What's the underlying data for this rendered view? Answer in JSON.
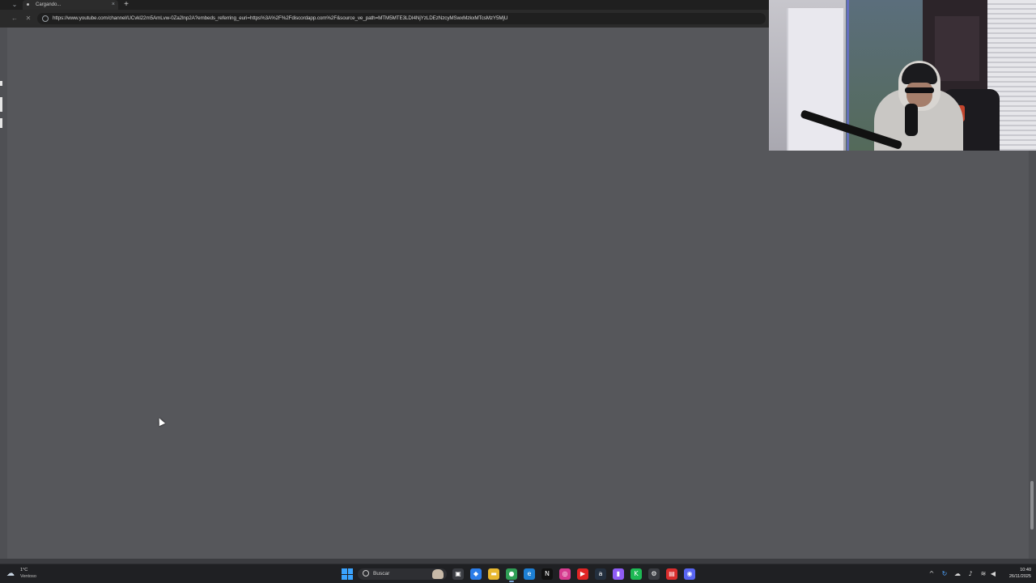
{
  "browser": {
    "tab": {
      "title": "Cargando...",
      "close_glyph": "×"
    },
    "new_tab_glyph": "+",
    "tab_menu_glyph": "⌄",
    "back_glyph": "←",
    "reload_glyph": "✕",
    "url": "https://www.youtube.com/channel/UCvkl22m5AmLvw-0Za2lnp2A?embeds_referring_euri=https%3A%2F%2Fdiscordapp.com%2F&source_ve_path=MTM5MTE3LDI4NjYzLDEzNzcyMSwxMzkxMTcsMzY5MjU"
  },
  "taskbar": {
    "weather": {
      "temp": "1°C",
      "desc": "Ventoso",
      "icon": "cloud-wind-icon"
    },
    "search_placeholder": "Buscar",
    "apps": [
      {
        "name": "task-view",
        "glyph": "▣",
        "color": "#3a3c42"
      },
      {
        "name": "copilot",
        "glyph": "◆",
        "color": "#2b7de9"
      },
      {
        "name": "file-explorer",
        "glyph": "▬",
        "color": "#e8b830"
      },
      {
        "name": "chrome",
        "glyph": "●",
        "color": "#2f9e55"
      },
      {
        "name": "edge",
        "glyph": "e",
        "color": "#1d7fd4"
      },
      {
        "name": "netflix",
        "glyph": "N",
        "color": "#111111"
      },
      {
        "name": "instagram",
        "glyph": "◎",
        "color": "#d63b8f"
      },
      {
        "name": "youtube",
        "glyph": "▶",
        "color": "#e02424"
      },
      {
        "name": "amazon",
        "glyph": "a",
        "color": "#232f3e"
      },
      {
        "name": "twitch",
        "glyph": "▮",
        "color": "#8f5cf5"
      },
      {
        "name": "kick",
        "glyph": "K",
        "color": "#1db954"
      },
      {
        "name": "settings",
        "glyph": "⚙",
        "color": "#3a3c42"
      },
      {
        "name": "pdf-reader",
        "glyph": "▤",
        "color": "#d92d2d"
      },
      {
        "name": "discord",
        "glyph": "◉",
        "color": "#5865f2"
      }
    ],
    "tray": {
      "chevron": "^",
      "clock_time": "10:40",
      "clock_date": "26/11/2025"
    }
  }
}
